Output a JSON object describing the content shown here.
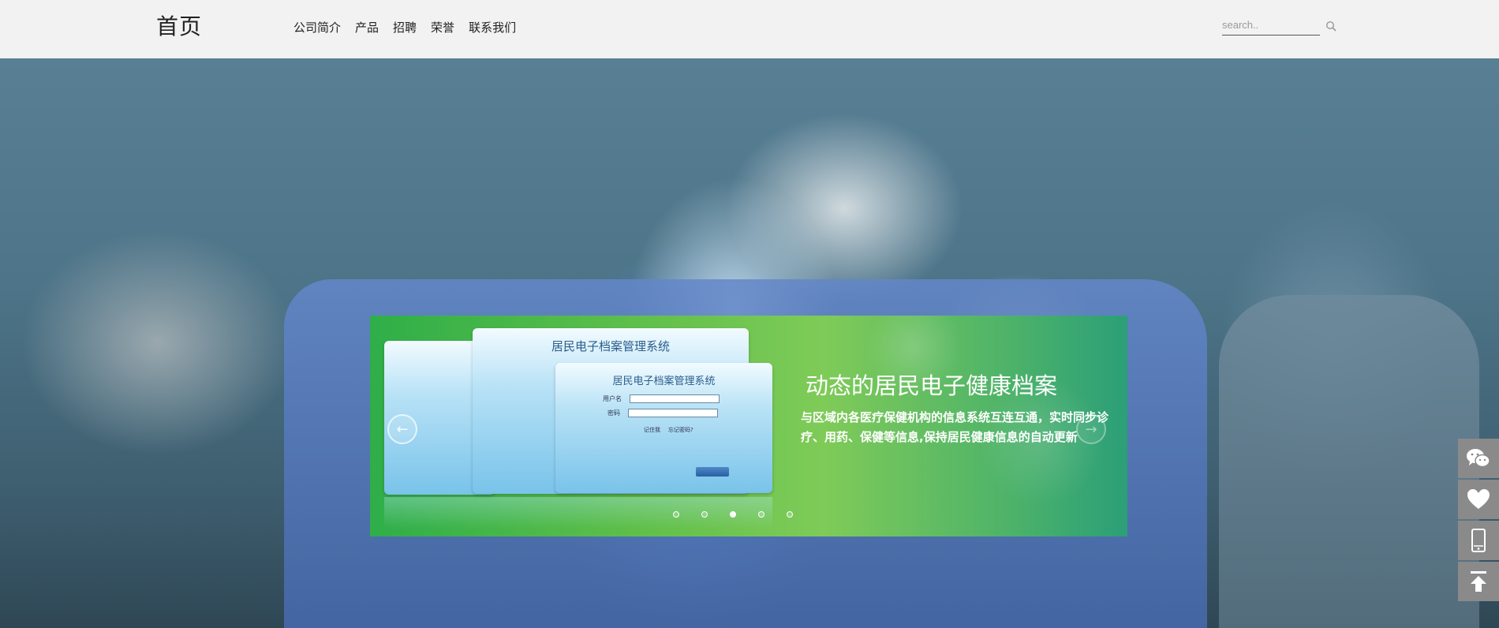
{
  "header": {
    "logo": "首页",
    "nav": [
      "公司简介",
      "产品",
      "招聘",
      "荣誉",
      "联系我们"
    ],
    "search": {
      "placeholder": "search..",
      "value": ""
    }
  },
  "slider": {
    "title": "动态的居民电子健康档案",
    "description": "与区域内各医疗保健机构的信息系统互连互通，实时同步诊疗、用药、保健等信息,保持居民健康信息的自动更新",
    "screen_title": "居民电子档案管理系统",
    "form": {
      "user_label": "用户名",
      "password_label": "密码",
      "remember_label": "记住我",
      "forgot_label": "忘记密码?"
    },
    "slide_count": 5,
    "active_slide": 3
  },
  "tools": [
    {
      "icon": "wechat-icon"
    },
    {
      "icon": "heart-icon"
    },
    {
      "icon": "mobile-icon"
    },
    {
      "icon": "back-to-top-icon"
    }
  ],
  "colors": {
    "header_bg": "#f2f2f2",
    "slide_green": "#5fbf4a",
    "tool_gray": "#8a8a8a"
  }
}
